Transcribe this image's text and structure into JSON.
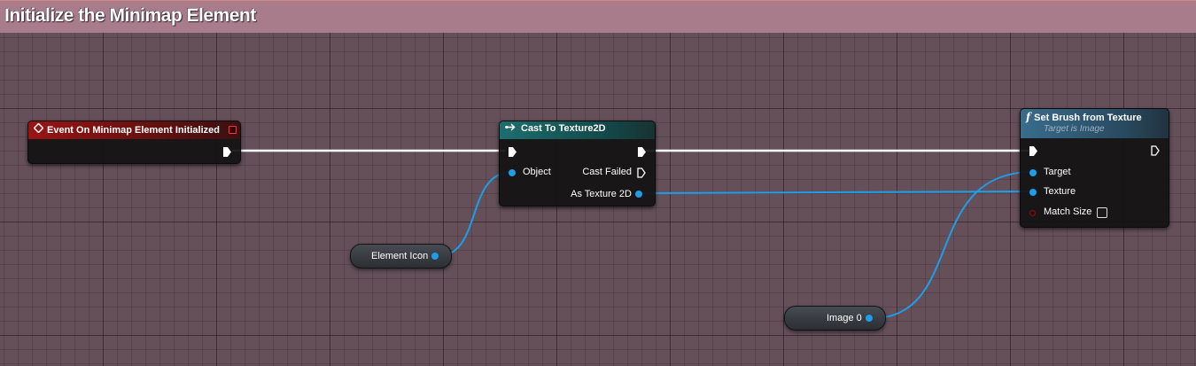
{
  "comment": {
    "title": "Initialize the Minimap Element"
  },
  "nodes": {
    "event": {
      "title": "Event On Minimap Element Initialized"
    },
    "cast": {
      "title": "Cast To Texture2D",
      "pins": {
        "object": "Object",
        "cast_failed": "Cast Failed",
        "as_texture": "As Texture 2D"
      }
    },
    "set_brush": {
      "title": "Set Brush from Texture",
      "subtitle": "Target is Image",
      "pins": {
        "target": "Target",
        "texture": "Texture",
        "match_size": "Match Size"
      },
      "match_size_checked": false
    }
  },
  "variables": {
    "element_icon": "Element Icon",
    "image": "Image 0"
  },
  "colors": {
    "graph_bg": "#65505a",
    "comment_header": "#a87c8a",
    "exec_wire": "#ffffff",
    "object_wire": "#1e9ee8",
    "event_header": "#9a1414",
    "cast_header": "#1d6e6e",
    "function_header": "#3a6c8c"
  },
  "icons": {
    "event": "event-diamond-icon",
    "cast": "cast-arrow-icon",
    "function": "function-f-icon",
    "delegate": "delegate-square-icon"
  }
}
